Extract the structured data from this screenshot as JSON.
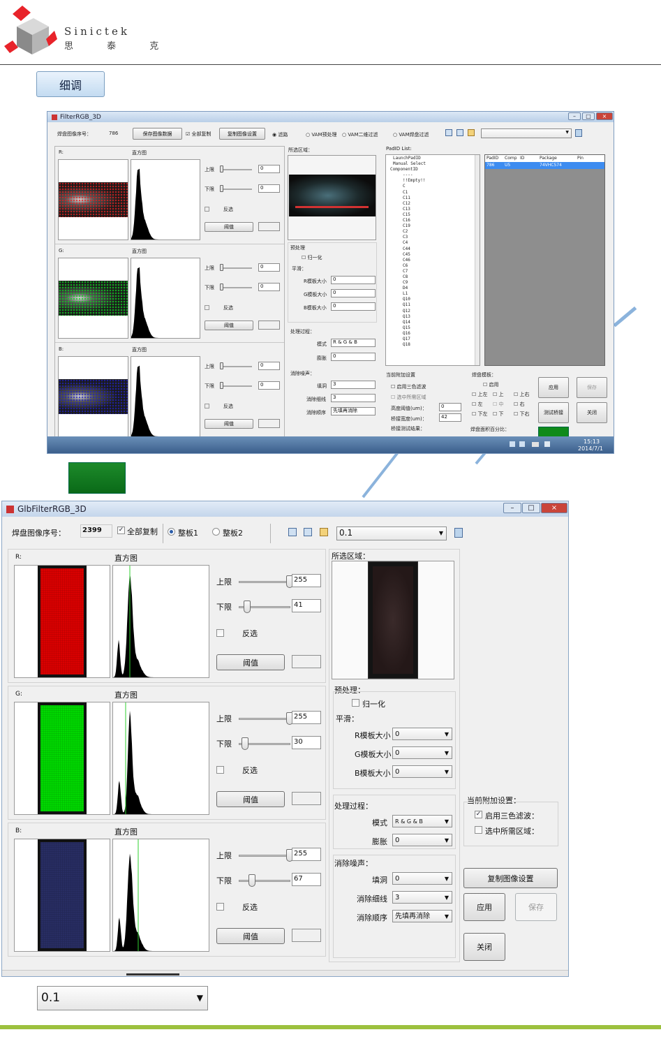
{
  "brand": {
    "name_en": "Sinictek",
    "name_cn": "思 泰 克"
  },
  "finetune_button": "细调",
  "shot1": {
    "title": "FilterRGB_3D",
    "toolbar": {
      "pad_index_label": "焊盘图像序号：",
      "pad_index_value": "786",
      "save_image_data": "保存图像数据",
      "copy_all": "全部复制",
      "copy_image_settings": "复制图像设置",
      "radio_filter": "滤路",
      "radio_vam_pre": "VAM预处理",
      "radio_vam_2d": "VAM二维过滤",
      "radio_vam_pad": "VAM焊盘过滤"
    },
    "channels": [
      {
        "label": "R:",
        "hist": "直方图",
        "upper": "上限",
        "lower": "下限",
        "upper_val": "0",
        "lower_val": "0",
        "invert": "反选",
        "threshold": "阈值"
      },
      {
        "label": "G:",
        "hist": "直方图",
        "upper": "上限",
        "lower": "下限",
        "upper_val": "0",
        "lower_val": "0",
        "invert": "反选",
        "threshold": "阈值"
      },
      {
        "label": "B:",
        "hist": "直方图",
        "upper": "上限",
        "lower": "下限",
        "upper_val": "0",
        "lower_val": "0",
        "invert": "反选",
        "threshold": "阈值"
      }
    ],
    "selected_region": "所选区域：",
    "preprocess": {
      "title": "预处理",
      "normalize": "归一化",
      "smooth": "平滑：",
      "r_size": "R模板大小",
      "r_val": "0",
      "g_size": "G模板大小",
      "g_val": "0",
      "b_size": "B模板大小",
      "b_val": "0"
    },
    "process": {
      "title": "处理过程：",
      "mode": "模式",
      "mode_val": "R & G & B",
      "dilate": "膨胀",
      "dilate_val": "0"
    },
    "noise": {
      "title": "消除噪声：",
      "fill": "填洞",
      "fill_val": "3",
      "thin": "消除细线",
      "thin_val": "3",
      "order": "消除顺序",
      "order_val": "先填再消除"
    },
    "padid_list": {
      "title": "PadID List:",
      "tree": [
        "LaunchPadID",
        "Manual Select",
        "ComponentID",
        "----",
        "!!Empty!!",
        "C",
        "C1",
        "C11",
        "C12",
        "C13",
        "C15",
        "C16",
        "C19",
        "C2",
        "C3",
        "C4",
        "C44",
        "C45",
        "C46",
        "C6",
        "C7",
        "C8",
        "C9",
        "D4",
        "L1",
        "Q10",
        "Q11",
        "Q12",
        "Q13",
        "Q14",
        "Q15",
        "Q16",
        "Q17",
        "Q18"
      ],
      "columns": [
        "PadID",
        "Comp",
        "ID",
        "Package",
        "Pin"
      ],
      "row": [
        "786",
        "U5",
        "",
        "74VHC574",
        ""
      ]
    },
    "extra": {
      "title": "当前附加设置",
      "tricolor": "启用三色滤波",
      "select_region": "选中所需区域",
      "height_label": "高度阈值(um)：",
      "height_val": "0",
      "width_label": "桥接宽度(um)：",
      "width_val": "42",
      "bridge_result": "桥接测试结果："
    },
    "pad_model": {
      "title": "焊盘模板：",
      "enable": "启用",
      "cells": [
        "上左",
        "上",
        "上右",
        "左",
        "中",
        "右",
        "下左",
        "下",
        "下右"
      ],
      "area_percent": "焊盘面积百分比："
    },
    "buttons": {
      "apply": "应用",
      "save": "保存",
      "test_bridge": "测试桥接",
      "close": "关闭"
    },
    "clock": {
      "time": "15:13",
      "date": "2014/7/1"
    }
  },
  "shot2": {
    "title": "GlbFilterRGB_3D",
    "toolbar": {
      "pad_index_label": "焊盘图像序号：",
      "pad_index_value": "2399",
      "copy_all": "全部复制",
      "board1": "整板1",
      "board2": "整板2",
      "combo_value": "0.1"
    },
    "channels": [
      {
        "label": "R:",
        "hist": "直方图",
        "upper": "上限",
        "lower": "下限",
        "upper_val": "255",
        "lower_val": "41",
        "invert": "反选",
        "threshold": "阈值",
        "upper_pos": 0.98,
        "lower_pos": 0.16
      },
      {
        "label": "G:",
        "hist": "直方图",
        "upper": "上限",
        "lower": "下限",
        "upper_val": "255",
        "lower_val": "30",
        "invert": "反选",
        "threshold": "阈值",
        "upper_pos": 0.98,
        "lower_pos": 0.12
      },
      {
        "label": "B:",
        "hist": "直方图",
        "upper": "上限",
        "lower": "下限",
        "upper_val": "255",
        "lower_val": "67",
        "invert": "反选",
        "threshold": "阈值",
        "upper_pos": 0.98,
        "lower_pos": 0.26
      }
    ],
    "selected_region": "所选区域：",
    "preprocess": {
      "title": "预处理：",
      "normalize": "归一化",
      "smooth": "平滑：",
      "r_size": "R模板大小",
      "r_val": "0",
      "g_size": "G模板大小",
      "g_val": "0",
      "b_size": "B模板大小",
      "b_val": "0"
    },
    "process": {
      "title": "处理过程：",
      "mode": "模式",
      "mode_val": "R & G & B",
      "dilate": "膨胀",
      "dilate_val": "0"
    },
    "noise": {
      "title": "消除噪声：",
      "fill": "填洞",
      "fill_val": "0",
      "thin": "消除细线",
      "thin_val": "3",
      "order": "消除顺序",
      "order_val": "先填再消除"
    },
    "extra": {
      "title": "当前附加设置：",
      "tricolor": "启用三色滤波：",
      "select_region": "选中所需区域："
    },
    "buttons": {
      "copy_image_settings": "复制图像设置",
      "apply": "应用",
      "save": "保存",
      "close": "关闭"
    }
  },
  "bottom_combo": "0.1",
  "colors": {
    "red": "#e00000",
    "green": "#00e000",
    "blue": "#2a2a6a",
    "footer": "#9cc13e",
    "accent": "#3a78c8"
  }
}
